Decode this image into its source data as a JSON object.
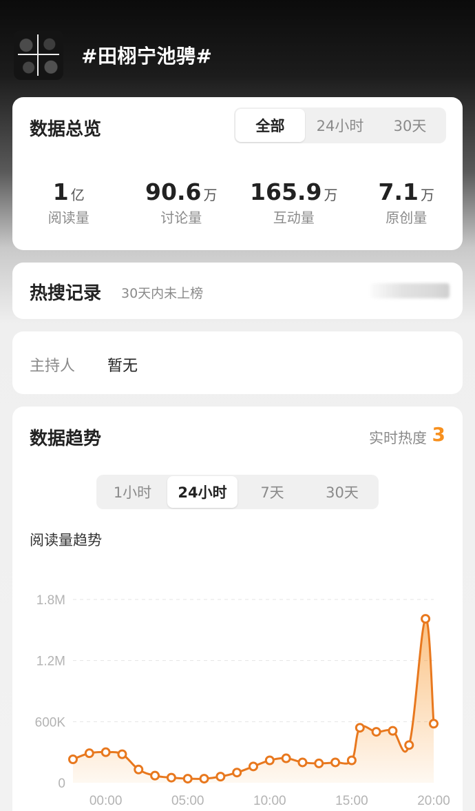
{
  "topic": {
    "title": "#田栩宁池骋#"
  },
  "overview": {
    "title": "数据总览",
    "tabs": [
      {
        "label": "全部",
        "active": true
      },
      {
        "label": "24小时",
        "active": false
      },
      {
        "label": "30天",
        "active": false
      }
    ],
    "stats": [
      {
        "value": "1",
        "unit": "亿",
        "label": "阅读量"
      },
      {
        "value": "90.6",
        "unit": "万",
        "label": "讨论量"
      },
      {
        "value": "165.9",
        "unit": "万",
        "label": "互动量"
      },
      {
        "value": "7.1",
        "unit": "万",
        "label": "原创量"
      }
    ]
  },
  "hot_search": {
    "title": "热搜记录",
    "subtitle": "30天内未上榜"
  },
  "host": {
    "label": "主持人",
    "value": "暂无"
  },
  "trend": {
    "title": "数据趋势",
    "heat_label": "实时热度",
    "heat_value": "3",
    "tabs": [
      {
        "label": "1小时",
        "active": false
      },
      {
        "label": "24小时",
        "active": true
      },
      {
        "label": "7天",
        "active": false
      },
      {
        "label": "30天",
        "active": false
      }
    ],
    "chart_label": "阅读量趋势"
  },
  "colors": {
    "accent": "#f7901e",
    "line": "#e8781e",
    "card": "#ffffff"
  },
  "icons": {
    "avatar": "topic-avatar-image"
  },
  "chart_data": {
    "type": "area",
    "title": "阅读量趋势",
    "xlabel": "",
    "ylabel": "",
    "x_ticks": [
      "00:00",
      "05:00",
      "10:00",
      "15:00",
      "20:00"
    ],
    "y_ticks": [
      "0",
      "600K",
      "1.2M",
      "1.8M"
    ],
    "ylim": [
      0,
      1800000
    ],
    "x_hours": [
      -2,
      -1,
      0,
      1,
      2,
      3,
      4,
      5,
      6,
      7,
      8,
      9,
      10,
      11,
      12,
      13,
      14,
      15,
      16,
      17,
      18,
      19,
      20
    ],
    "values": [
      230000,
      290000,
      300000,
      280000,
      130000,
      70000,
      50000,
      40000,
      40000,
      60000,
      100000,
      160000,
      220000,
      240000,
      200000,
      190000,
      200000,
      220000,
      540000,
      500000,
      510000,
      370000,
      1610000,
      580000
    ],
    "x_hours_full": [
      -2,
      -1,
      0,
      1,
      2,
      3,
      4,
      5,
      6,
      7,
      8,
      9,
      10,
      11,
      12,
      13,
      14,
      15,
      15.5,
      16.5,
      17.5,
      18.5,
      19.5,
      20
    ],
    "grid": true,
    "legend": "none"
  }
}
